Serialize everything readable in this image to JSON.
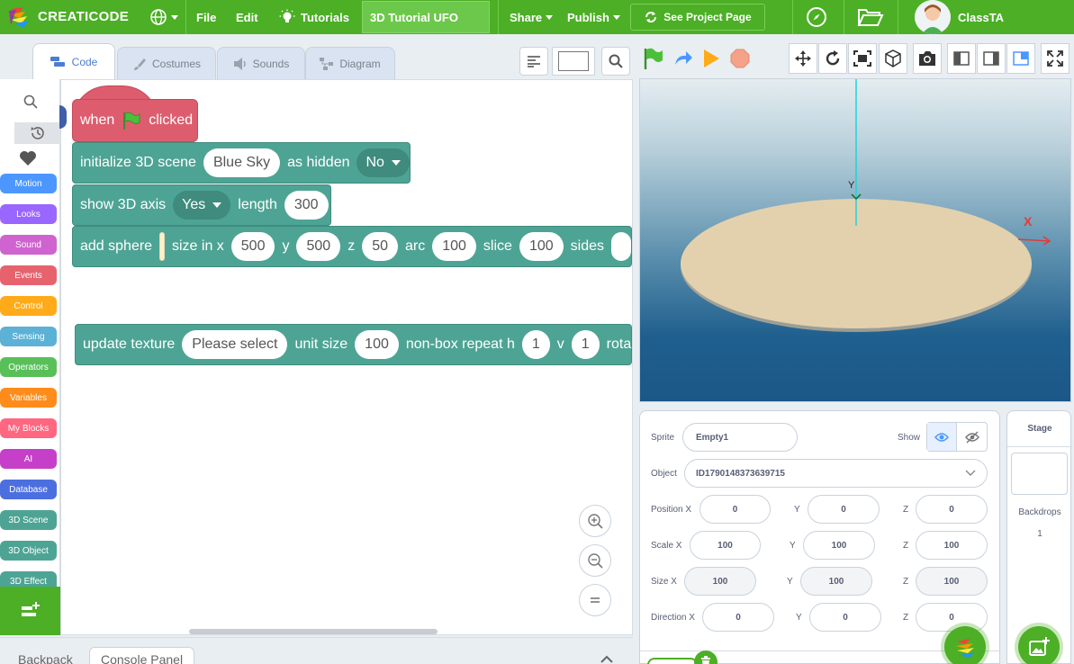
{
  "menu": {
    "logo_text": "CREATICODE",
    "file": "File",
    "edit": "Edit",
    "tutorials": "Tutorials",
    "project_title": "3D Tutorial UFO",
    "share": "Share",
    "publish": "Publish",
    "see_project": "See Project Page",
    "username": "ClassTA"
  },
  "tabs": {
    "code": "Code",
    "costumes": "Costumes",
    "sounds": "Sounds",
    "diagram": "Diagram"
  },
  "categories": [
    {
      "label": "Motion",
      "color": "#4c97ff"
    },
    {
      "label": "Looks",
      "color": "#9966ff"
    },
    {
      "label": "Sound",
      "color": "#cf63cf"
    },
    {
      "label": "Events",
      "color": "#e6636e"
    },
    {
      "label": "Control",
      "color": "#ffab19"
    },
    {
      "label": "Sensing",
      "color": "#5cb1d6"
    },
    {
      "label": "Operators",
      "color": "#59c059"
    },
    {
      "label": "Variables",
      "color": "#ff8c1a"
    },
    {
      "label": "My Blocks",
      "color": "#ff6680"
    },
    {
      "label": "AI",
      "color": "#c63fc9"
    },
    {
      "label": "Database",
      "color": "#4c6fe0"
    },
    {
      "label": "3D Scene",
      "color": "#4ea494"
    },
    {
      "label": "3D Object",
      "color": "#4ea494"
    },
    {
      "label": "3D Effect",
      "color": "#4ea494"
    }
  ],
  "blocks": {
    "hat": {
      "when": "when",
      "clicked": "clicked"
    },
    "init": {
      "label": "initialize 3D scene",
      "scene": "Blue Sky",
      "hidden_label": "as hidden",
      "hidden": "No"
    },
    "axis": {
      "label": "show 3D axis",
      "show": "Yes",
      "length_label": "length",
      "length": "300"
    },
    "sphere": {
      "label": "add sphere",
      "size_label": "size in x",
      "x": "500",
      "y_label": "y",
      "y": "500",
      "z_label": "z",
      "z": "50",
      "arc_label": "arc",
      "arc": "100",
      "slice_label": "slice",
      "slice": "100",
      "sides_label": "sides",
      "color": "#fdf0cc"
    },
    "texture": {
      "label": "update texture",
      "texture": "Please select",
      "unit_label": "unit size",
      "unit": "100",
      "repeat_label": "non-box repeat h",
      "h": "1",
      "v_label": "v",
      "v": "1",
      "rot_label": "rota"
    }
  },
  "bottom": {
    "backpack": "Backpack",
    "console": "Console Panel"
  },
  "stage": {
    "y_axis": "Y",
    "x_axis": "X",
    "accent": "#e53935"
  },
  "sprite": {
    "sprite_label": "Sprite",
    "sprite_name": "Empty1",
    "show_label": "Show",
    "object_label": "Object",
    "object_id": "ID1790148373639715",
    "position_label": "Position X",
    "pos_x": "0",
    "pos_y": "0",
    "pos_z": "0",
    "scale_label": "Scale X",
    "scale_x": "100",
    "scale_y": "100",
    "scale_z": "100",
    "size_label": "Size X",
    "size_x": "100",
    "size_y": "100",
    "size_z": "100",
    "direction_label": "Direction X",
    "dir_x": "0",
    "dir_y": "0",
    "dir_z": "0",
    "y_label": "Y",
    "z_label": "Z"
  },
  "stage_panel": {
    "title": "Stage",
    "backdrops_label": "Backdrops",
    "backdrops_count": "1"
  }
}
